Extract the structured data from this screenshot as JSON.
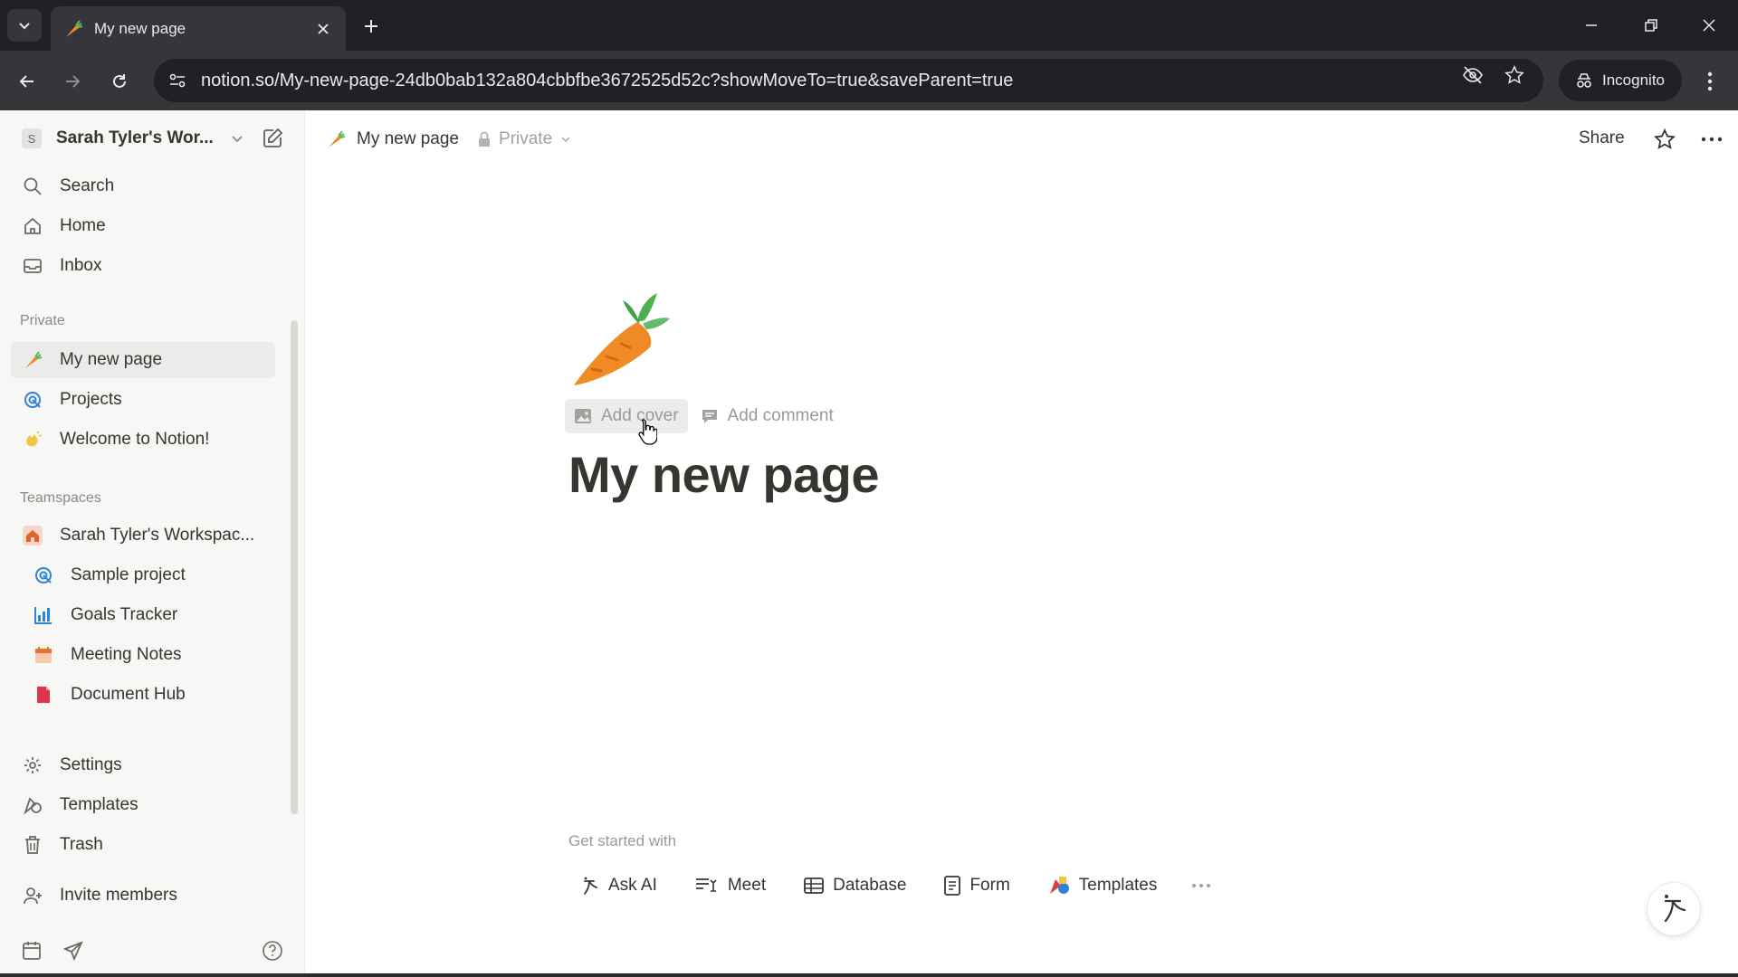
{
  "browser": {
    "tab_title": "My new page",
    "url": "notion.so/My-new-page-24db0bab132a804cbbfbe3672525d52c?showMoveTo=true&saveParent=true",
    "incognito_label": "Incognito",
    "colors": {
      "tabbar": "#202124",
      "toolbar": "#35363a"
    }
  },
  "sidebar": {
    "workspace_initial": "S",
    "workspace_name": "Sarah Tyler's Wor...",
    "nav": [
      {
        "label": "Search",
        "icon": "search-icon"
      },
      {
        "label": "Home",
        "icon": "home-icon"
      },
      {
        "label": "Inbox",
        "icon": "inbox-icon"
      }
    ],
    "private_section": "Private",
    "private_pages": [
      {
        "label": "My new page",
        "icon": "carrot-icon",
        "active": true
      },
      {
        "label": "Projects",
        "icon": "target-icon"
      },
      {
        "label": "Welcome to Notion!",
        "icon": "wave-icon"
      }
    ],
    "teamspaces_section": "Teamspaces",
    "teamspace": {
      "label": "Sarah Tyler's Workspac...",
      "icon": "house-icon"
    },
    "team_pages": [
      {
        "label": "Sample project",
        "icon": "target-icon"
      },
      {
        "label": "Goals Tracker",
        "icon": "chart-icon"
      },
      {
        "label": "Meeting Notes",
        "icon": "calendar-icon"
      },
      {
        "label": "Document Hub",
        "icon": "document-icon"
      }
    ],
    "footer_nav": [
      {
        "label": "Settings",
        "icon": "gear-icon"
      },
      {
        "label": "Templates",
        "icon": "templates-icon"
      },
      {
        "label": "Trash",
        "icon": "trash-icon"
      }
    ],
    "invite_label": "Invite members"
  },
  "topbar": {
    "breadcrumb_title": "My new page",
    "privacy": "Private",
    "share_label": "Share"
  },
  "page": {
    "add_cover": "Add cover",
    "add_comment": "Add comment",
    "title": "My new page",
    "get_started_label": "Get started with",
    "get_started": [
      {
        "label": "Ask AI",
        "icon": "ai-icon"
      },
      {
        "label": "Meet",
        "icon": "meet-icon"
      },
      {
        "label": "Database",
        "icon": "table-icon"
      },
      {
        "label": "Form",
        "icon": "form-icon"
      },
      {
        "label": "Templates",
        "icon": "templates-color-icon"
      }
    ]
  }
}
